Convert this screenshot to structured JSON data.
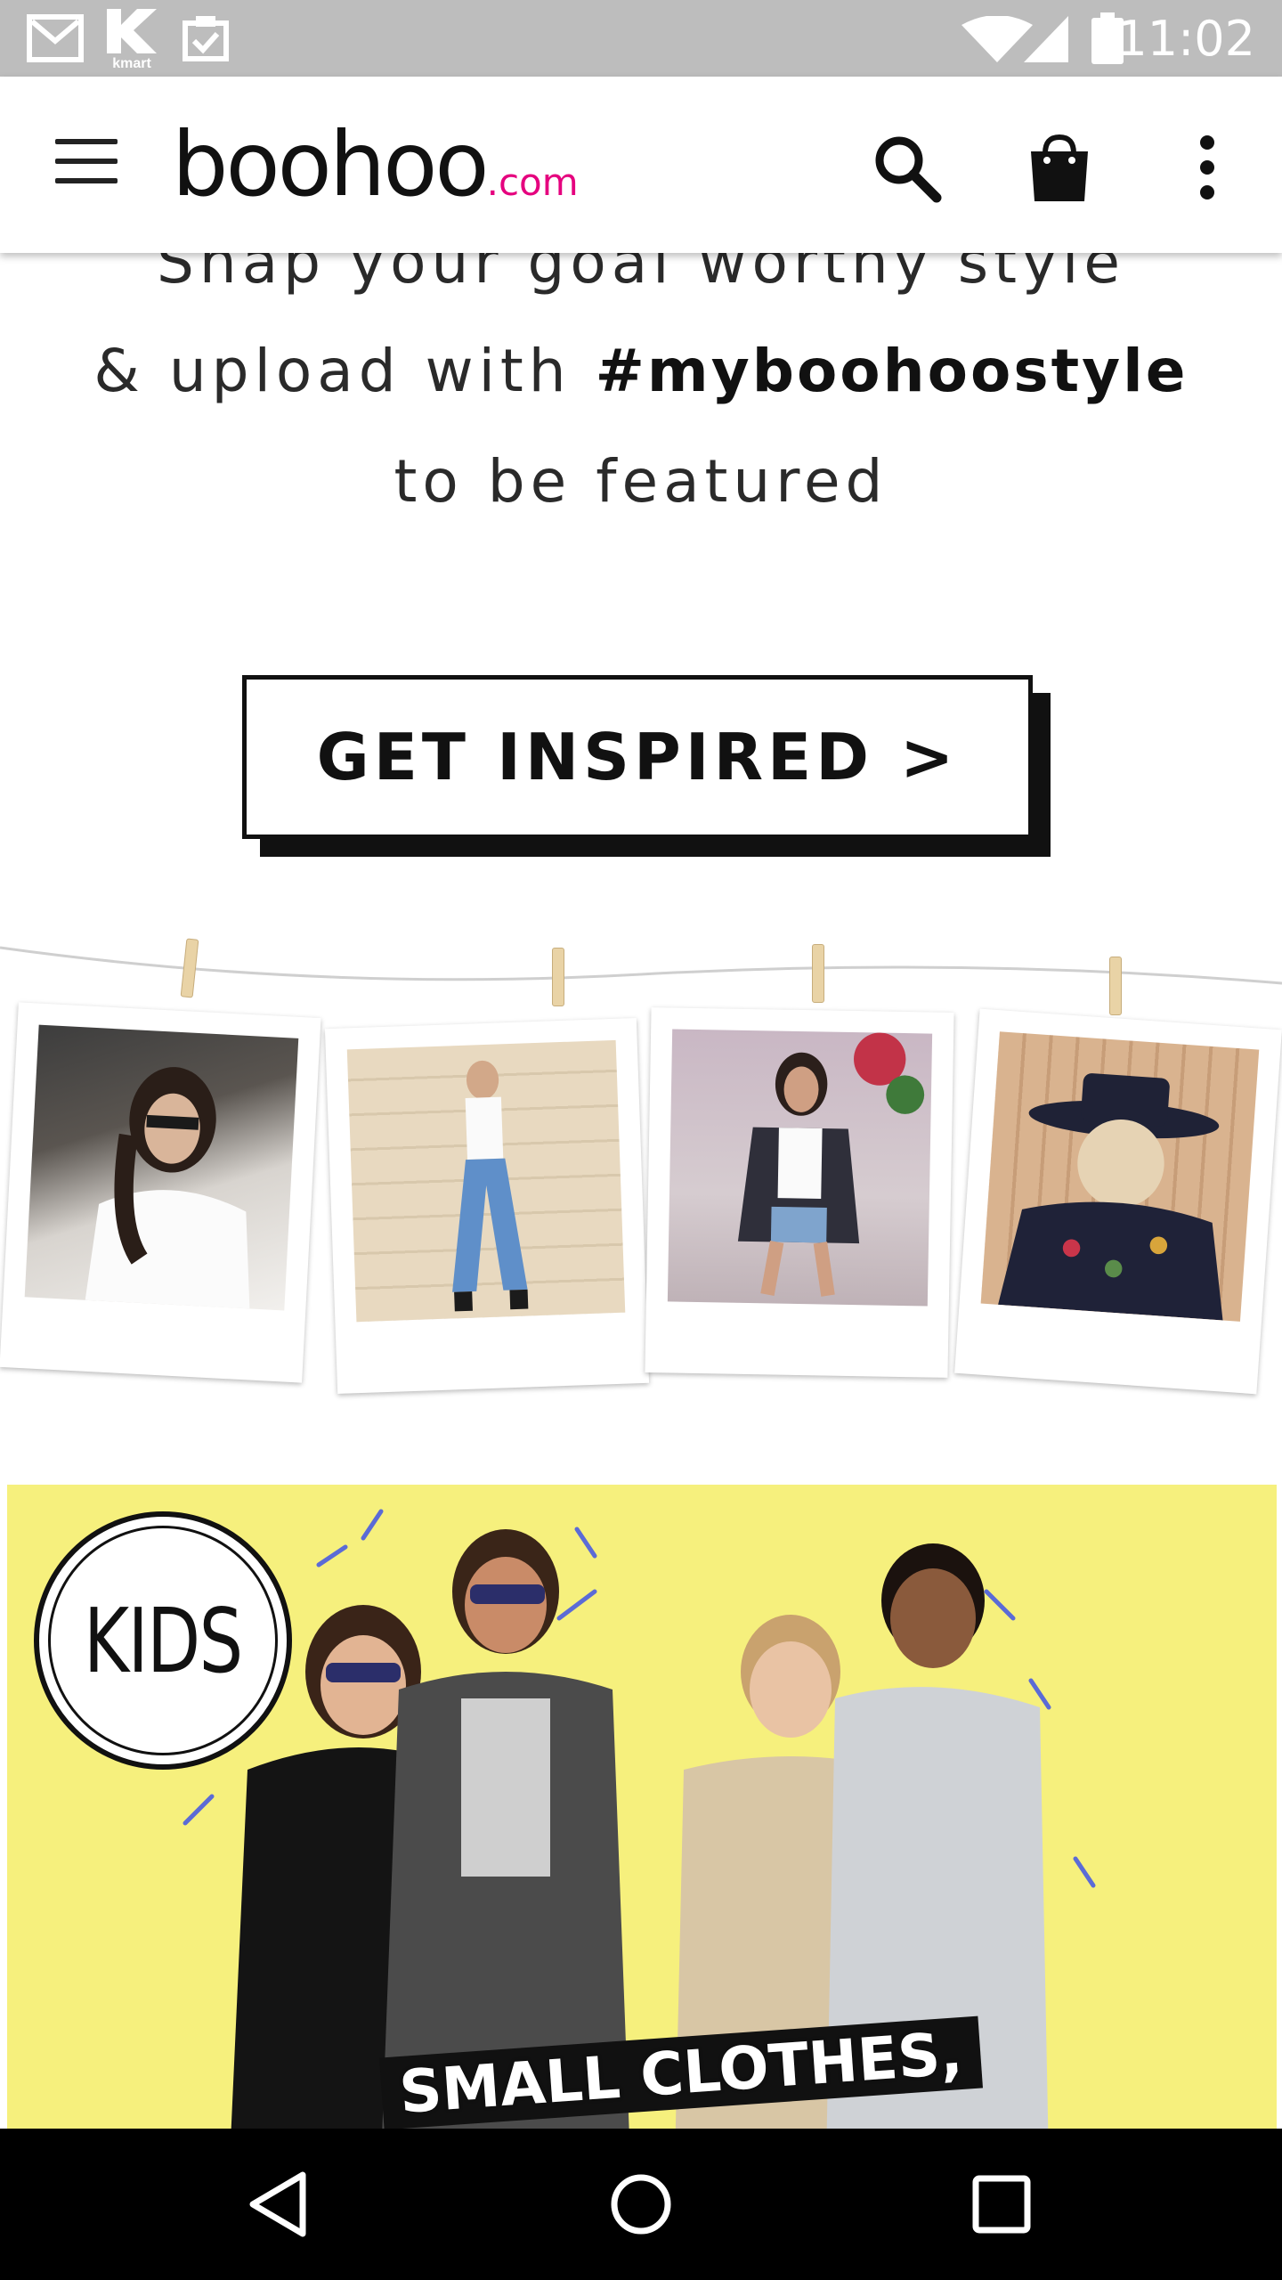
{
  "status_bar": {
    "time": "11:02",
    "kmart_label": "kmart",
    "icons": [
      "gmail-icon",
      "kmart-icon",
      "clipboard-check-icon",
      "wifi-icon",
      "signal-icon",
      "battery-icon"
    ]
  },
  "app_bar": {
    "logo_main": "boohoo",
    "logo_suffix": ".com",
    "icons": [
      "menu-icon",
      "search-icon",
      "shopping-bag-icon",
      "more-vert-icon"
    ]
  },
  "promo": {
    "line1": "Snap your goal worthy style",
    "line2_prefix": "& upload with ",
    "line2_hashtag": "#myboohoostyle",
    "line3": "to be featured",
    "cta_label": "GET INSPIRED >"
  },
  "kids_banner": {
    "badge_label": "KIDS",
    "caption": "SMALL CLOTHES,"
  },
  "colors": {
    "brand_pink": "#e5007e",
    "banner_yellow": "#f6f07d",
    "status_bar": "#bdbdbd"
  },
  "nav_bar": {
    "icons": [
      "back-icon",
      "home-icon",
      "recents-icon"
    ]
  }
}
